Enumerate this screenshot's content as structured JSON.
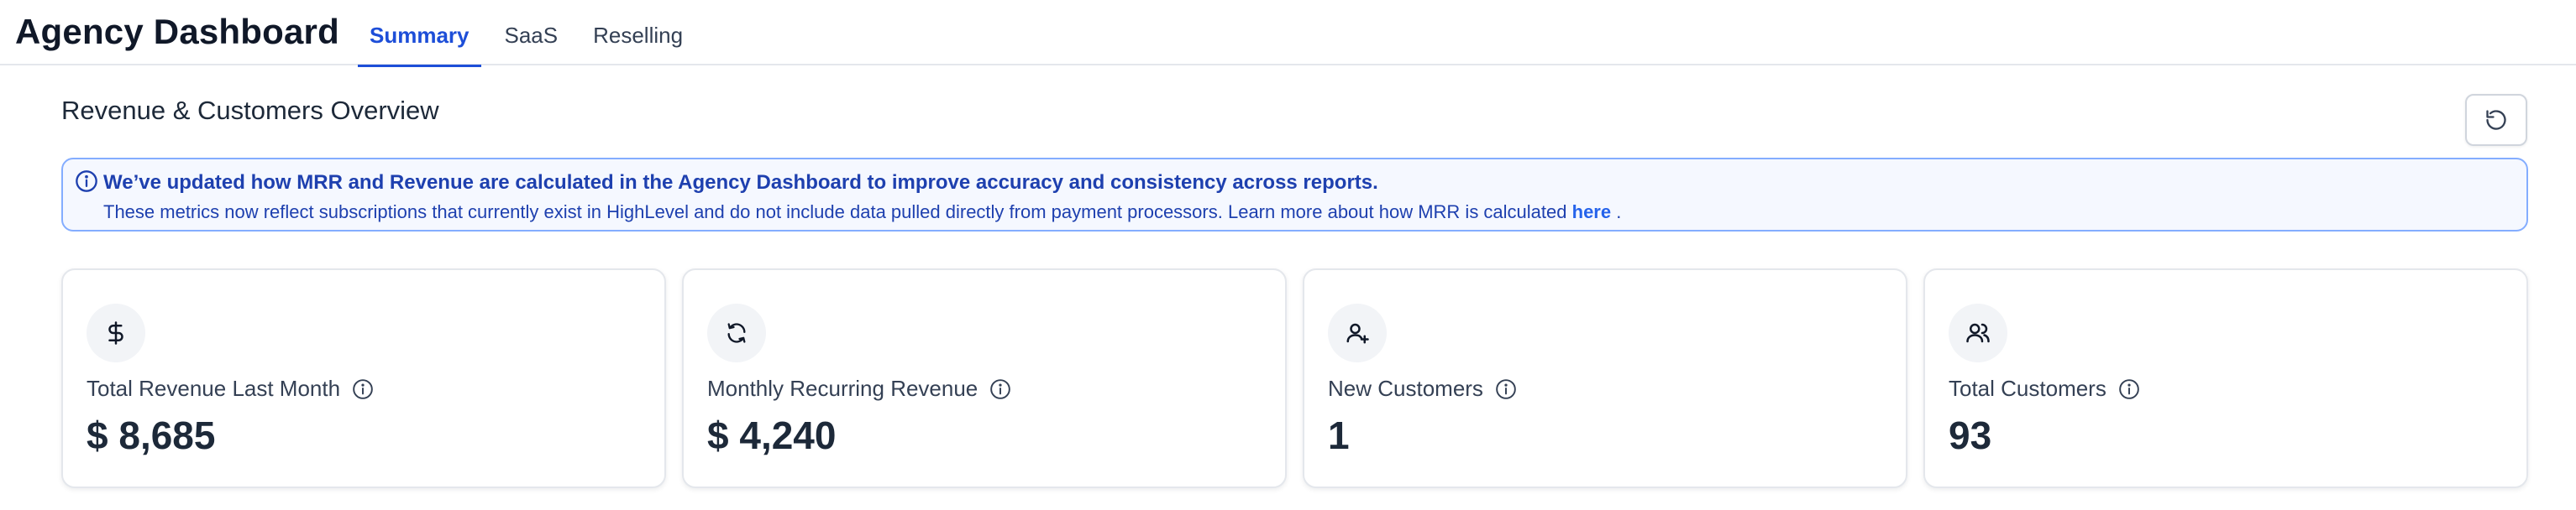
{
  "header": {
    "title": "Agency Dashboard",
    "tabs": [
      {
        "label": "Summary",
        "active": true
      },
      {
        "label": "SaaS",
        "active": false
      },
      {
        "label": "Reselling",
        "active": false
      }
    ]
  },
  "overview": {
    "title": "Revenue & Customers Overview",
    "refresh_icon": "refresh-icon"
  },
  "alert": {
    "title": "We’ve updated how MRR and Revenue are calculated in the Agency Dashboard to improve accuracy and consistency across reports.",
    "body": "These metrics now reflect subscriptions that currently exist in HighLevel and do not include data pulled directly from payment processors. Learn more about how MRR is calculated ",
    "link": "here",
    "suffix": " .",
    "color": "#1e40af"
  },
  "cards": [
    {
      "icon": "dollar-icon",
      "label": "Total Revenue Last Month",
      "value": "$ 8,685"
    },
    {
      "icon": "recurring-icon",
      "label": "Monthly Recurring Revenue",
      "value": "$ 4,240"
    },
    {
      "icon": "user-plus-icon",
      "label": "New Customers",
      "value": "1"
    },
    {
      "icon": "users-icon",
      "label": "Total Customers",
      "value": "93"
    }
  ],
  "colors": {
    "accent": "#1d4ed8",
    "alert_border": "#84adff",
    "alert_bg": "#f5f8ff"
  }
}
